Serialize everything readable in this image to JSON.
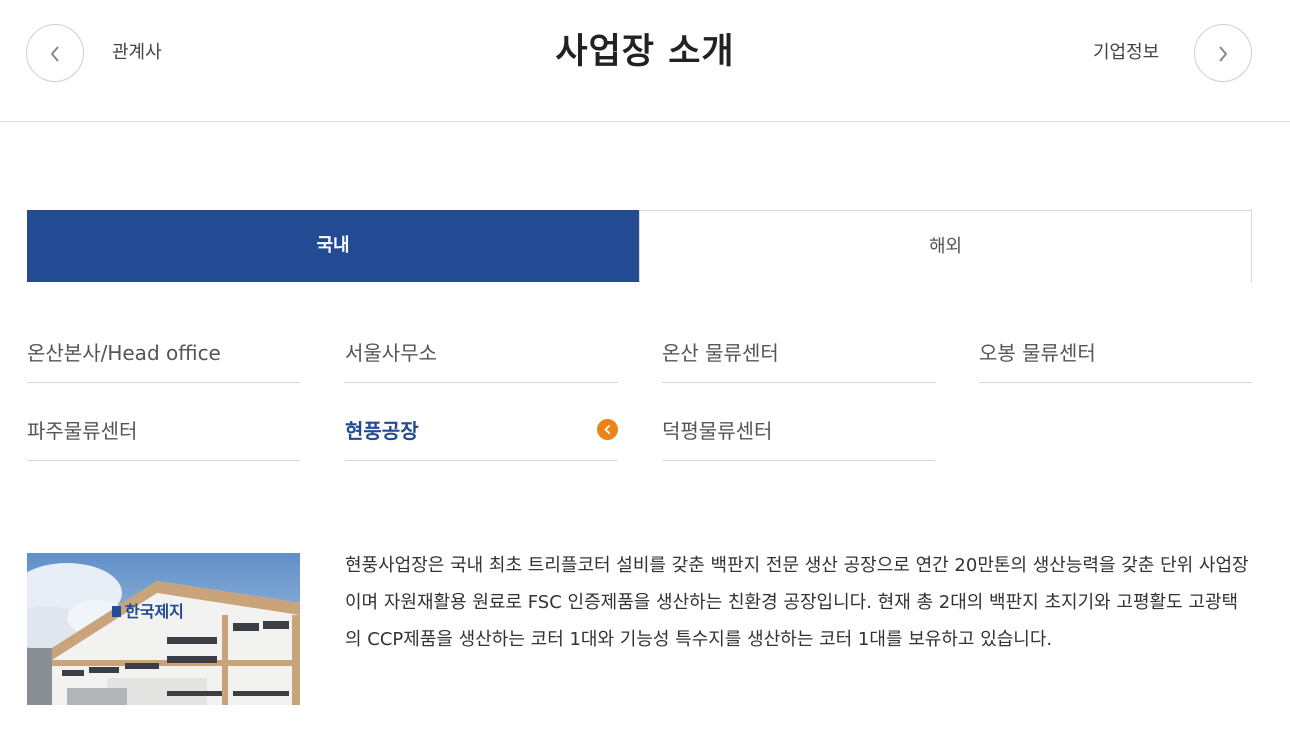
{
  "header": {
    "title": "사업장 소개",
    "prev_label": "관계사",
    "next_label": "기업정보"
  },
  "tabs": [
    {
      "label": "국내",
      "active": true
    },
    {
      "label": "해외",
      "active": false
    }
  ],
  "sites": [
    {
      "label": "온산본사/Head office",
      "active": false
    },
    {
      "label": "서울사무소",
      "active": false
    },
    {
      "label": "온산 물류센터",
      "active": false
    },
    {
      "label": "오봉 물류센터",
      "active": false
    },
    {
      "label": "파주물류센터",
      "active": false
    },
    {
      "label": "현풍공장",
      "active": true
    },
    {
      "label": "덕평물류센터",
      "active": false
    }
  ],
  "detail": {
    "photo_sign": "한국제지",
    "description": "현풍사업장은 국내 최초 트리플코터 설비를 갖춘 백판지 전문 생산 공장으로 연간 20만톤의 생산능력을 갖춘 단위 사업장이며 자원재활용 원료로 FSC 인증제품을 생산하는 친환경 공장입니다. 현재 총 2대의 백판지 초지기와 고평활도 고광택의 CCP제품을 생산하는 코터 1대와 기능성 특수지를 생산하는 코터 1대를 보유하고 있습니다."
  },
  "colors": {
    "accent": "#224b94",
    "active_icon": "#e8841a"
  },
  "icons": {
    "prev": "chevron-left-icon",
    "next": "chevron-right-icon",
    "active": "chevron-left-icon"
  }
}
